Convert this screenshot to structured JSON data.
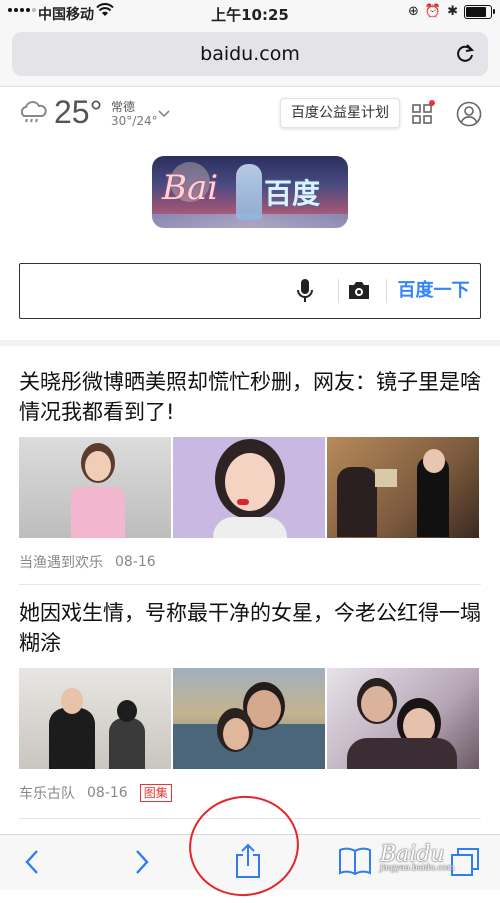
{
  "status_bar": {
    "carrier": "中国移动",
    "time": "上午10:25",
    "battery_level": 0.9
  },
  "browser": {
    "url": "baidu.com"
  },
  "weather": {
    "temperature": "25°",
    "city": "常德",
    "range": "30°/24°"
  },
  "header": {
    "promo_tip": "百度公益星计划"
  },
  "logo_text": {
    "bai": "Bai",
    "du": "百度"
  },
  "search": {
    "button_label": "百度一下",
    "placeholder": ""
  },
  "news": [
    {
      "title": "关晓彤微博晒美照却慌忙秒删，网友：镜子里是啥情况我都看到了!",
      "source": "当渔遇到欢乐",
      "date": "08-16",
      "tag": ""
    },
    {
      "title": "她因戏生情，号称最干净的女星，今老公红得一塌糊涂",
      "source": "车乐古队",
      "date": "08-16",
      "tag": "图集"
    }
  ],
  "watermark": {
    "brand": "Baidu",
    "sub": "jingyan.baidu.com"
  },
  "colors": {
    "accent": "#3385ff",
    "annotation": "#e2262b",
    "toolbar_icon": "#2f7cf6"
  }
}
